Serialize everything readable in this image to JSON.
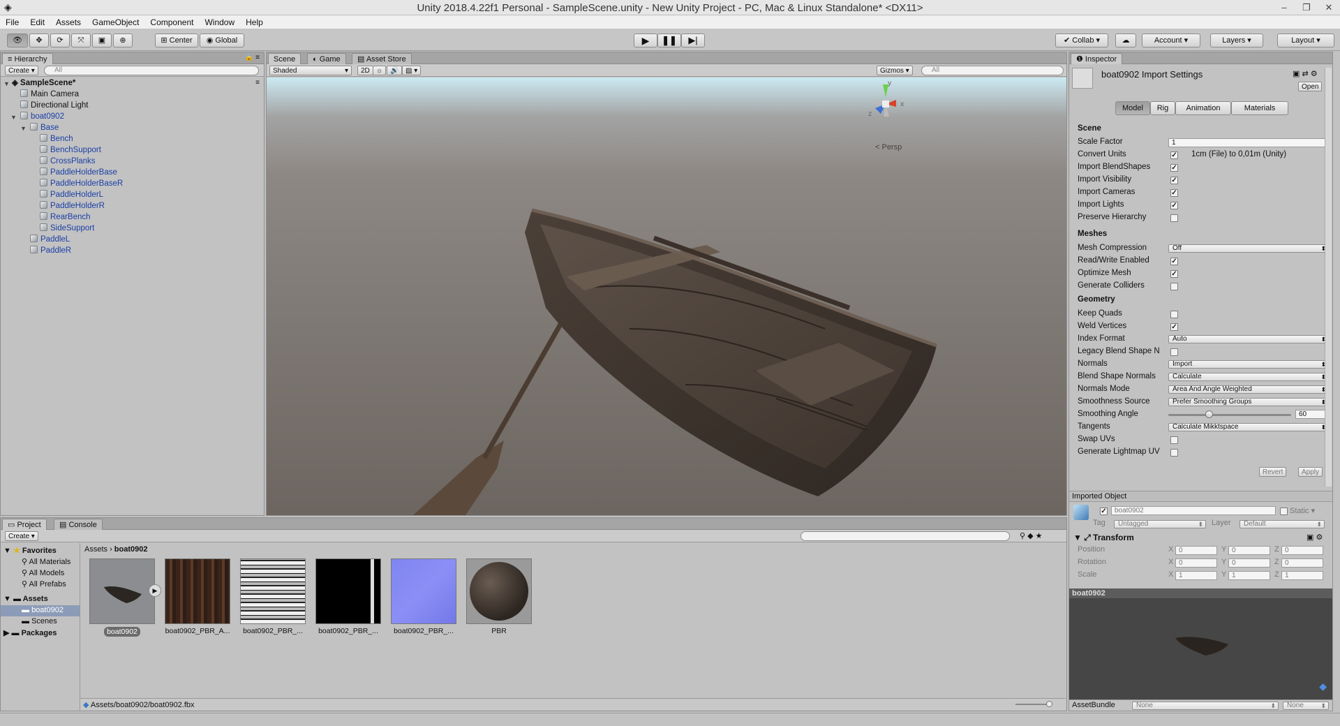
{
  "window": {
    "title": "Unity 2018.4.22f1 Personal - SampleScene.unity - New Unity Project - PC, Mac & Linux Standalone* <DX11>",
    "controls": [
      "–",
      "❐",
      "✕"
    ]
  },
  "menu": [
    "File",
    "Edit",
    "Assets",
    "GameObject",
    "Component",
    "Window",
    "Help"
  ],
  "toolbar": {
    "pivot": "Center",
    "space": "Global",
    "collab": "Collab",
    "account": "Account",
    "layers": "Layers",
    "layout": "Layout"
  },
  "hierarchy": {
    "tab": "Hierarchy",
    "create": "Create",
    "search_placeholder": "All",
    "scene": "SampleScene*",
    "items": [
      {
        "label": "Main Camera",
        "blue": false
      },
      {
        "label": "Directional Light",
        "blue": false
      },
      {
        "label": "boat0902",
        "blue": true
      },
      {
        "label": "Base",
        "blue": true
      },
      {
        "label": "Bench",
        "blue": true
      },
      {
        "label": "BenchSupport",
        "blue": true
      },
      {
        "label": "CrossPlanks",
        "blue": true
      },
      {
        "label": "PaddleHolderBase",
        "blue": true
      },
      {
        "label": "PaddleHolderBaseR",
        "blue": true
      },
      {
        "label": "PaddleHolderL",
        "blue": true
      },
      {
        "label": "PaddleHolderR",
        "blue": true
      },
      {
        "label": "RearBench",
        "blue": true
      },
      {
        "label": "SideSupport",
        "blue": true
      },
      {
        "label": "PaddleL",
        "blue": true
      },
      {
        "label": "PaddleR",
        "blue": true
      }
    ]
  },
  "scene_view": {
    "tabs": [
      "Scene",
      "Game",
      "Asset Store"
    ],
    "shading": "Shaded",
    "mode_2d": "2D",
    "gizmos": "Gizmos",
    "search_placeholder": "All",
    "persp": "< Persp",
    "axes": {
      "y": "y",
      "x": "x",
      "z": "z"
    }
  },
  "inspector": {
    "tab": "Inspector",
    "asset_title": "boat0902 Import Settings",
    "open": "Open",
    "tabs": [
      "Model",
      "Rig",
      "Animation",
      "Materials"
    ],
    "scene_header": "Scene",
    "scale_factor_label": "Scale Factor",
    "scale_factor": "1",
    "convert_units_label": "Convert Units",
    "convert_units_note": "1cm (File) to 0,01m (Unity)",
    "import_blendshapes": "Import BlendShapes",
    "import_visibility": "Import Visibility",
    "import_cameras": "Import Cameras",
    "import_lights": "Import Lights",
    "preserve_hierarchy": "Preserve Hierarchy",
    "meshes_header": "Meshes",
    "mesh_compression_label": "Mesh Compression",
    "mesh_compression": "Off",
    "read_write": "Read/Write Enabled",
    "optimize_mesh": "Optimize Mesh",
    "generate_colliders": "Generate Colliders",
    "geometry_header": "Geometry",
    "keep_quads": "Keep Quads",
    "weld_vertices": "Weld Vertices",
    "index_format_label": "Index Format",
    "index_format": "Auto",
    "legacy_blend": "Legacy Blend Shape N",
    "normals_label": "Normals",
    "normals": "Import",
    "blend_normals_label": "Blend Shape Normals",
    "blend_normals": "Calculate",
    "normals_mode_label": "Normals Mode",
    "normals_mode": "Area And Angle Weighted",
    "smoothness_label": "Smoothness Source",
    "smoothness": "Prefer Smoothing Groups",
    "smoothing_angle_label": "Smoothing Angle",
    "smoothing_angle": "60",
    "smoothing_angle_fraction": 0.33,
    "tangents_label": "Tangents",
    "tangents": "Calculate Mikktspace",
    "swap_uvs": "Swap UVs",
    "gen_lightmap": "Generate Lightmap UV",
    "revert": "Revert",
    "apply": "Apply",
    "imported_object": "Imported Object",
    "obj_name": "boat0902",
    "static": "Static",
    "tag_label": "Tag",
    "tag": "Untagged",
    "layer_label": "Layer",
    "layer": "Default",
    "transform": "Transform",
    "position_label": "Position",
    "rotation_label": "Rotation",
    "scale_label": "Scale",
    "pos": [
      "0",
      "0",
      "0"
    ],
    "rot": [
      "0",
      "0",
      "0"
    ],
    "scl": [
      "1",
      "1",
      "1"
    ],
    "axis_x": "X",
    "axis_y": "Y",
    "axis_z": "Z",
    "preview_title": "boat0902",
    "assetbundle_label": "AssetBundle",
    "assetbundle": "None",
    "assetbundle_variant": "None"
  },
  "project": {
    "tabs": [
      "Project",
      "Console"
    ],
    "create": "Create",
    "favorites": "Favorites",
    "fav_items": [
      "All Materials",
      "All Models",
      "All Prefabs"
    ],
    "assets": "Assets",
    "folders": [
      "boat0902",
      "Scenes"
    ],
    "packages": "Packages",
    "breadcrumb_root": "Assets",
    "breadcrumb_current": "boat0902",
    "items": [
      "boat0902",
      "boat0902_PBR_A...",
      "boat0902_PBR_...",
      "boat0902_PBR_...",
      "boat0902_PBR_...",
      "PBR"
    ],
    "path": "Assets/boat0902/boat0902.fbx"
  }
}
